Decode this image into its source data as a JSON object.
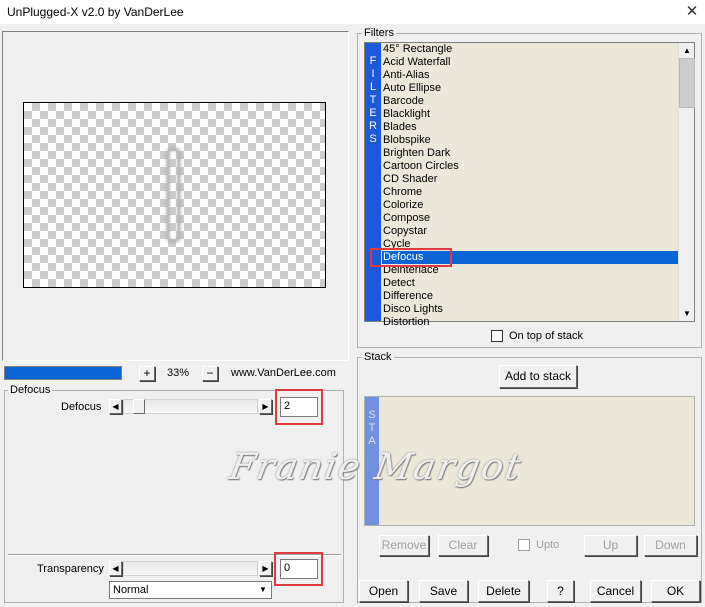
{
  "window": {
    "title": "UnPlugged-X v2.0 by VanDerLee",
    "close_glyph": "✕"
  },
  "preview": {
    "zoom": "33%",
    "zoom_plus": "+",
    "zoom_minus": "−",
    "website": "www.VanDerLee.com",
    "progress_fraction": 1.0
  },
  "params": {
    "group_label": "Defocus",
    "defocus": {
      "label": "Defocus",
      "value": "2",
      "slider_fraction": 0.08
    },
    "transparency": {
      "label": "Transparency",
      "value": "0",
      "slider_fraction": 0.0
    },
    "blend_mode": {
      "selected": "Normal"
    }
  },
  "filters": {
    "label": "Filters",
    "strip_letters": [
      "F",
      "I",
      "L",
      "T",
      "E",
      "R",
      "S"
    ],
    "items": [
      "45° Rectangle",
      "Acid Waterfall",
      "Anti-Alias",
      "Auto Ellipse",
      "Barcode",
      "Blacklight",
      "Blades",
      "Blobspike",
      "Brighten Dark",
      "Cartoon Circles",
      "CD Shader",
      "Chrome",
      "Colorize",
      "Compose",
      "Copystar",
      "Cycle",
      "Defocus",
      "Deinterlace",
      "Detect",
      "Difference",
      "Disco Lights",
      "Distortion"
    ],
    "selected": "Defocus",
    "on_top_label": "On top of stack"
  },
  "stack": {
    "label": "Stack",
    "add_label": "Add to stack",
    "strip_letters": [
      "S",
      "T",
      "A"
    ],
    "remove_label": "Remove",
    "clear_label": "Clear",
    "upto_label": "Upto",
    "up_label": "Up",
    "down_label": "Down"
  },
  "buttons": {
    "open": "Open",
    "save": "Save",
    "delete": "Delete",
    "help": "?",
    "cancel": "Cancel",
    "ok": "OK"
  },
  "watermark": "Franie Margot",
  "colors": {
    "selection": "#0a64d6",
    "strip": "#1c59d8",
    "list_bg": "#ebe7da",
    "highlight": "#e0393f"
  }
}
